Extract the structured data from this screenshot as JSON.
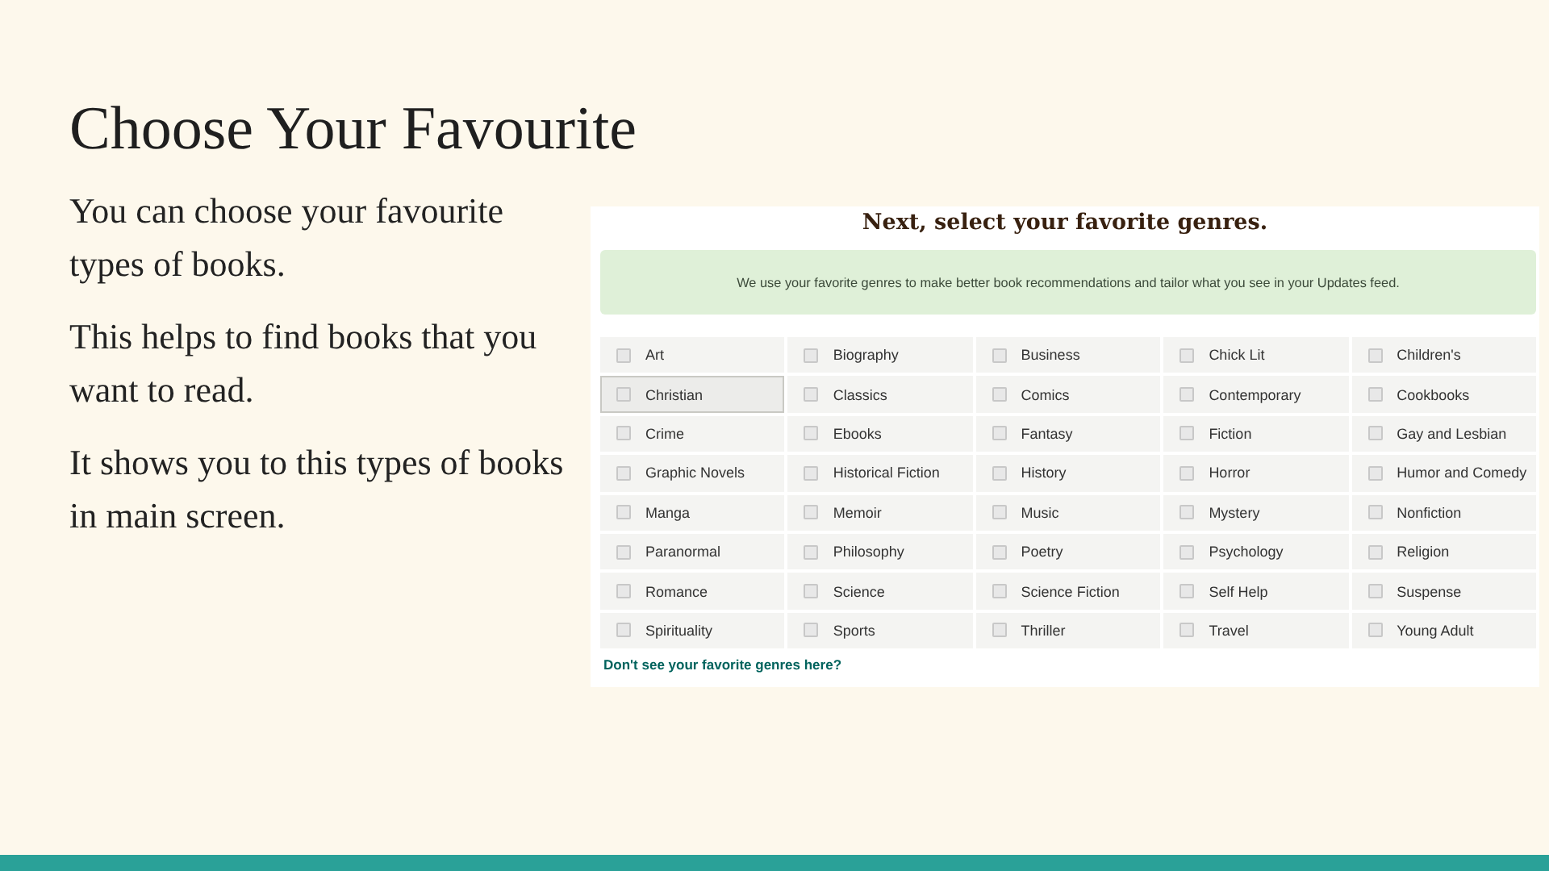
{
  "slide": {
    "title": "Choose Your Favourite",
    "paragraphs": [
      "You can choose your favourite types of books.",
      "This helps to find books that you want to read.",
      "It shows you to this types of books in main screen."
    ]
  },
  "genre_screen": {
    "heading": "Next, select your favorite genres.",
    "notice": "We use your favorite genres to make better book recommendations and tailor what you see in your Updates feed.",
    "genres": [
      {
        "label": "Art",
        "checked": false,
        "highlighted": false
      },
      {
        "label": "Biography",
        "checked": false,
        "highlighted": false
      },
      {
        "label": "Business",
        "checked": false,
        "highlighted": false
      },
      {
        "label": "Chick Lit",
        "checked": false,
        "highlighted": false
      },
      {
        "label": "Children's",
        "checked": false,
        "highlighted": false
      },
      {
        "label": "Christian",
        "checked": false,
        "highlighted": true
      },
      {
        "label": "Classics",
        "checked": false,
        "highlighted": false
      },
      {
        "label": "Comics",
        "checked": false,
        "highlighted": false
      },
      {
        "label": "Contemporary",
        "checked": false,
        "highlighted": false
      },
      {
        "label": "Cookbooks",
        "checked": false,
        "highlighted": false
      },
      {
        "label": "Crime",
        "checked": false,
        "highlighted": false
      },
      {
        "label": "Ebooks",
        "checked": false,
        "highlighted": false
      },
      {
        "label": "Fantasy",
        "checked": false,
        "highlighted": false
      },
      {
        "label": "Fiction",
        "checked": false,
        "highlighted": false
      },
      {
        "label": "Gay and Lesbian",
        "checked": false,
        "highlighted": false
      },
      {
        "label": "Graphic Novels",
        "checked": false,
        "highlighted": false
      },
      {
        "label": "Historical Fiction",
        "checked": false,
        "highlighted": false
      },
      {
        "label": "History",
        "checked": false,
        "highlighted": false
      },
      {
        "label": "Horror",
        "checked": false,
        "highlighted": false
      },
      {
        "label": "Humor and Comedy",
        "checked": false,
        "highlighted": false
      },
      {
        "label": "Manga",
        "checked": false,
        "highlighted": false
      },
      {
        "label": "Memoir",
        "checked": false,
        "highlighted": false
      },
      {
        "label": "Music",
        "checked": false,
        "highlighted": false
      },
      {
        "label": "Mystery",
        "checked": false,
        "highlighted": false
      },
      {
        "label": "Nonfiction",
        "checked": false,
        "highlighted": false
      },
      {
        "label": "Paranormal",
        "checked": false,
        "highlighted": false
      },
      {
        "label": "Philosophy",
        "checked": false,
        "highlighted": false
      },
      {
        "label": "Poetry",
        "checked": false,
        "highlighted": false
      },
      {
        "label": "Psychology",
        "checked": false,
        "highlighted": false
      },
      {
        "label": "Religion",
        "checked": false,
        "highlighted": false
      },
      {
        "label": "Romance",
        "checked": false,
        "highlighted": false
      },
      {
        "label": "Science",
        "checked": false,
        "highlighted": false
      },
      {
        "label": "Science Fiction",
        "checked": false,
        "highlighted": false
      },
      {
        "label": "Self Help",
        "checked": false,
        "highlighted": false
      },
      {
        "label": "Suspense",
        "checked": false,
        "highlighted": false
      },
      {
        "label": "Spirituality",
        "checked": false,
        "highlighted": false
      },
      {
        "label": "Sports",
        "checked": false,
        "highlighted": false
      },
      {
        "label": "Thriller",
        "checked": false,
        "highlighted": false
      },
      {
        "label": "Travel",
        "checked": false,
        "highlighted": false
      },
      {
        "label": "Young Adult",
        "checked": false,
        "highlighted": false
      }
    ],
    "link": "Don't see your favorite genres here?"
  }
}
